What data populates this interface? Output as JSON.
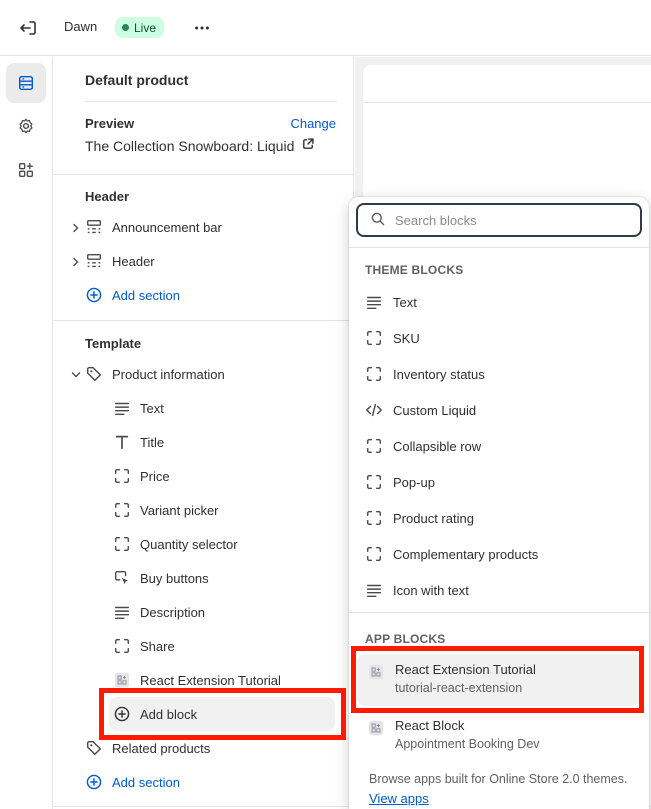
{
  "topbar": {
    "theme_name": "Dawn",
    "live_badge": "Live",
    "icons": {
      "exit": "exit-icon",
      "more": "more-horizontal-icon"
    }
  },
  "rail": {
    "icons": [
      "sections-icon",
      "settings-gear-icon",
      "apps-icon"
    ]
  },
  "sidebar": {
    "title": "Default product",
    "preview": {
      "label": "Preview",
      "change": "Change",
      "value": "The Collection Snowboard: Liquid"
    },
    "header_group": {
      "label": "Header",
      "items": [
        "Announcement bar",
        "Header"
      ],
      "add_section": "Add section"
    },
    "template_group": {
      "label": "Template",
      "section": "Product information",
      "blocks": [
        {
          "label": "Text",
          "icon": "text-lines-icon"
        },
        {
          "label": "Title",
          "icon": "title-t-icon"
        },
        {
          "label": "Price",
          "icon": "block-frame-icon"
        },
        {
          "label": "Variant picker",
          "icon": "block-frame-icon"
        },
        {
          "label": "Quantity selector",
          "icon": "block-frame-icon"
        },
        {
          "label": "Buy buttons",
          "icon": "cursor-click-icon"
        },
        {
          "label": "Description",
          "icon": "text-lines-icon"
        },
        {
          "label": "Share",
          "icon": "block-frame-icon"
        },
        {
          "label": "React Extension Tutorial",
          "icon": "app-block-icon"
        }
      ],
      "add_block": "Add block",
      "related": "Related products",
      "add_section": "Add section"
    }
  },
  "popover": {
    "search_placeholder": "Search blocks",
    "theme_heading": "THEME BLOCKS",
    "theme_blocks": [
      {
        "label": "Text",
        "icon": "text-lines-icon"
      },
      {
        "label": "SKU",
        "icon": "block-frame-icon"
      },
      {
        "label": "Inventory status",
        "icon": "block-frame-icon"
      },
      {
        "label": "Custom Liquid",
        "icon": "code-icon"
      },
      {
        "label": "Collapsible row",
        "icon": "block-frame-icon"
      },
      {
        "label": "Pop-up",
        "icon": "block-frame-icon"
      },
      {
        "label": "Product rating",
        "icon": "block-frame-icon"
      },
      {
        "label": "Complementary products",
        "icon": "block-frame-icon"
      },
      {
        "label": "Icon with text",
        "icon": "text-lines-icon"
      }
    ],
    "app_heading": "APP BLOCKS",
    "app_blocks": [
      {
        "title": "React Extension Tutorial",
        "subtitle": "tutorial-react-extension"
      },
      {
        "title": "React Block",
        "subtitle": "Appointment Booking Dev"
      }
    ],
    "footer_text": "Browse apps built for Online Store 2.0 themes.",
    "footer_link": "View apps"
  },
  "colors": {
    "accent": "#005bd3",
    "highlight": "#ff1a00",
    "live_bg": "#cdfee1",
    "live_text": "#0c5132"
  }
}
